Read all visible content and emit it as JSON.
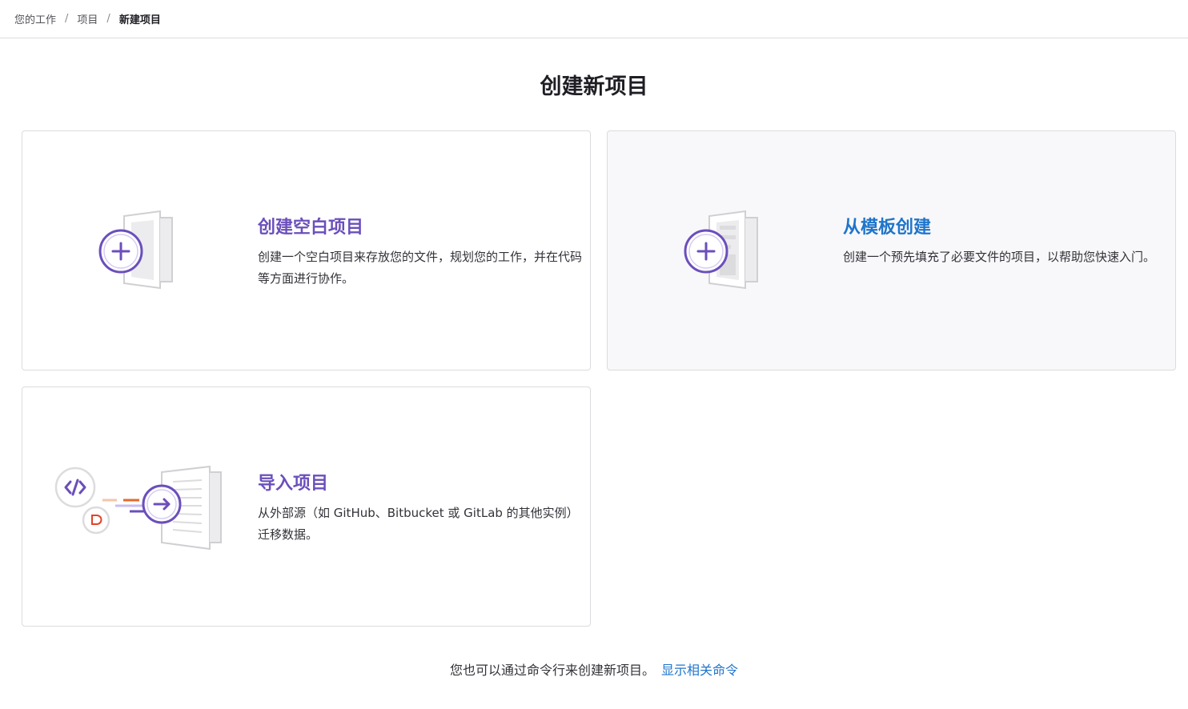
{
  "breadcrumb": {
    "items": [
      "您的工作",
      "项目",
      "新建项目"
    ],
    "separator": "/"
  },
  "page": {
    "title": "创建新项目"
  },
  "cards": [
    {
      "title": "创建空白项目",
      "description": "创建一个空白项目来存放您的文件，规划您的工作，并在代码等方面进行协作。",
      "icon": "blank-project-icon"
    },
    {
      "title": "从模板创建",
      "description": "创建一个预先填充了必要文件的项目，以帮助您快速入门。",
      "icon": "template-project-icon"
    },
    {
      "title": "导入项目",
      "description": "从外部源（如 GitHub、Bitbucket 或 GitLab 的其他实例）迁移数据。",
      "icon": "import-project-icon"
    }
  ],
  "footer": {
    "text": "您也可以通过命令行来创建新项目。",
    "link": "显示相关命令"
  },
  "colors": {
    "purple": "#6b4fbb",
    "blue": "#1f75cb",
    "orange": "#e24329"
  }
}
